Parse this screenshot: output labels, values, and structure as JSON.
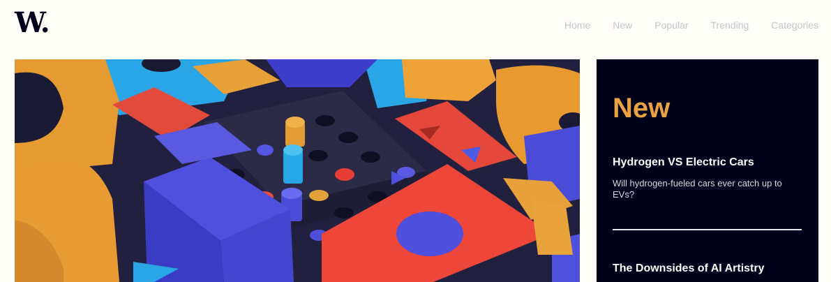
{
  "logo": "W.",
  "nav": [
    "Home",
    "New",
    "Popular",
    "Trending",
    "Categories"
  ],
  "hero": {
    "image": "colorful-3d-blocks-illustration"
  },
  "panel": {
    "title": "New",
    "articles": [
      {
        "title": "Hydrogen VS Electric Cars",
        "description": "Will hydrogen-fueled cars ever catch up to EVs?"
      },
      {
        "title": "The Downsides of AI Artistry",
        "description": ""
      }
    ]
  },
  "colors": {
    "accent": "#e9a142",
    "dark": "#00001a",
    "background": "#fffdf8",
    "nav": "#c5c6cc"
  }
}
